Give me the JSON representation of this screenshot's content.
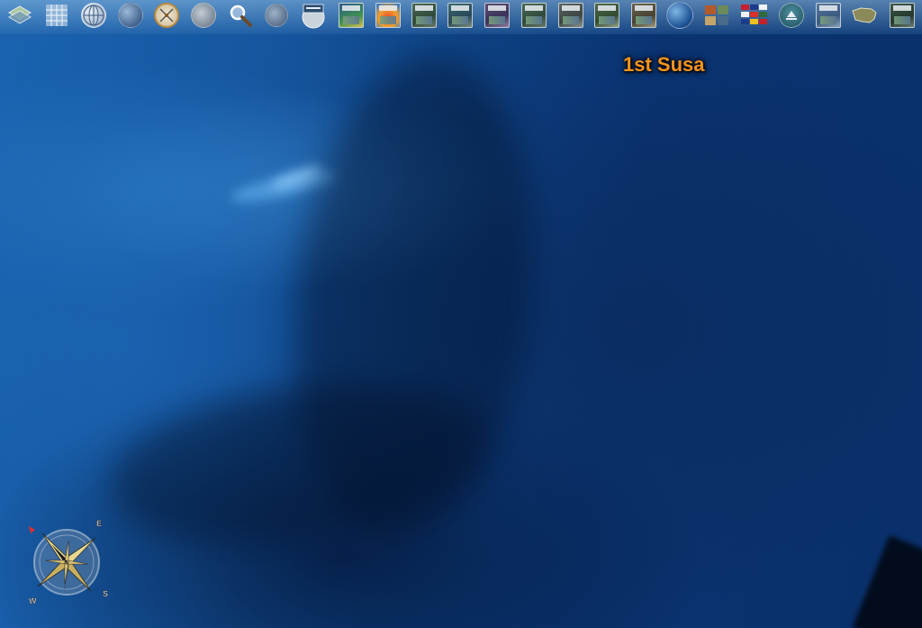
{
  "map": {
    "place_label": "1st Susa"
  },
  "toolbar": {
    "items": [
      {
        "name": "layer-manager-icon"
      },
      {
        "name": "graticule-icon"
      },
      {
        "name": "globe-grid-icon"
      },
      {
        "name": "earth-icon"
      },
      {
        "name": "compass-icon"
      },
      {
        "name": "stars-globe-icon"
      },
      {
        "name": "search-icon"
      },
      {
        "name": "atmosphere-globe-icon"
      },
      {
        "name": "place-names-icon"
      },
      {
        "name": "wms-icon"
      },
      {
        "name": "heatmap-icon"
      },
      {
        "name": "imagery-layer-1-icon"
      },
      {
        "name": "imagery-layer-2-icon"
      },
      {
        "name": "imagery-layer-3-icon"
      },
      {
        "name": "imagery-layer-4-icon"
      },
      {
        "name": "imagery-layer-5-icon"
      },
      {
        "name": "imagery-layer-6-icon"
      },
      {
        "name": "imagery-layer-7-icon"
      },
      {
        "name": "blue-marble-icon"
      },
      {
        "name": "photo-grid-icon"
      },
      {
        "name": "country-flags-icon"
      },
      {
        "name": "landmarks-icon"
      },
      {
        "name": "world-map-icon"
      },
      {
        "name": "usa-map-icon"
      },
      {
        "name": "more-layers-icon"
      }
    ]
  },
  "compass": {
    "name": "compass-rose",
    "letters": {
      "e": "E",
      "s": "S",
      "w": "W"
    }
  }
}
